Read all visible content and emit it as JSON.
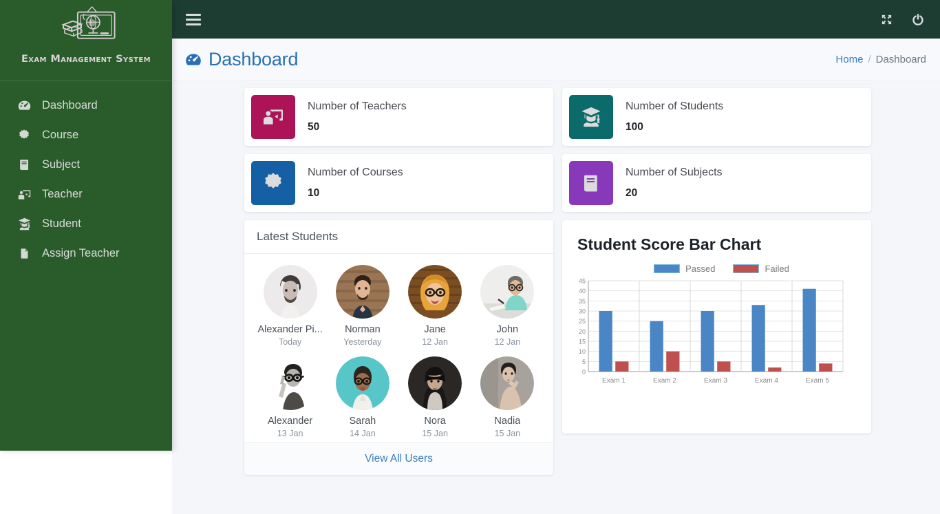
{
  "sidebar": {
    "brand_title": "Exam Management System",
    "logo_icon": "blackboard-globe-books-logo",
    "items": [
      {
        "label": "Dashboard",
        "icon": "tachometer-icon"
      },
      {
        "label": "Course",
        "icon": "certificate-icon"
      },
      {
        "label": "Subject",
        "icon": "book-icon"
      },
      {
        "label": "Teacher",
        "icon": "chalkboard-teacher-icon"
      },
      {
        "label": "Student",
        "icon": "user-graduate-icon"
      },
      {
        "label": "Assign Teacher",
        "icon": "file-icon"
      }
    ]
  },
  "topbar": {
    "menu_icon": "hamburger-icon",
    "fullscreen_icon": "expand-arrows-icon",
    "power_icon": "power-off-icon"
  },
  "page": {
    "title": "Dashboard",
    "title_icon": "tachometer-icon",
    "breadcrumb": {
      "home": "Home",
      "separator": "/",
      "current": "Dashboard"
    }
  },
  "stats": [
    {
      "label": "Number of Teachers",
      "value": "50",
      "icon": "chalkboard-teacher-icon",
      "color": "#ad1457"
    },
    {
      "label": "Number of Students",
      "value": "100",
      "icon": "user-graduate-icon",
      "color": "#0b6b6b"
    },
    {
      "label": "Number of Courses",
      "value": "10",
      "icon": "certificate-icon",
      "color": "#1560a4"
    },
    {
      "label": "Number of Subjects",
      "value": "20",
      "icon": "book-icon",
      "color": "#8739ba"
    }
  ],
  "students_panel": {
    "title": "Latest Students",
    "view_all_label": "View All Users",
    "students": [
      {
        "name": "Alexander Pi...",
        "date": "Today",
        "avatar": "man-beard-grayscale-avatar"
      },
      {
        "name": "Norman",
        "date": "Yesterday",
        "avatar": "man-wood-background-avatar"
      },
      {
        "name": "Jane",
        "date": "12 Jan",
        "avatar": "woman-glasses-orange-avatar"
      },
      {
        "name": "John",
        "date": "12 Jan",
        "avatar": "man-desk-writing-avatar"
      },
      {
        "name": "Alexander",
        "date": "13 Jan",
        "avatar": "man-glasses-pointing-avatar"
      },
      {
        "name": "Sarah",
        "date": "14 Jan",
        "avatar": "woman-glasses-teal-avatar"
      },
      {
        "name": "Nora",
        "date": "15 Jan",
        "avatar": "woman-dark-hair-avatar"
      },
      {
        "name": "Nadia",
        "date": "15 Jan",
        "avatar": "woman-hand-chin-avatar"
      }
    ]
  },
  "chart_data": {
    "type": "bar",
    "title": "Student Score Bar Chart",
    "categories": [
      "Exam 1",
      "Exam 2",
      "Exam 3",
      "Exam 4",
      "Exam 5"
    ],
    "series": [
      {
        "name": "Passed",
        "color": "#4a86c5",
        "values": [
          30,
          25,
          30,
          33,
          41
        ]
      },
      {
        "name": "Failed",
        "color": "#c0504d",
        "values": [
          5,
          10,
          5,
          2,
          4
        ]
      }
    ],
    "xlabel": "",
    "ylabel": "",
    "ylim": [
      0,
      45
    ],
    "yticks": [
      0,
      5,
      10,
      15,
      20,
      25,
      30,
      35,
      40,
      45
    ],
    "grid": true,
    "legend_position": "top"
  },
  "colors": {
    "sidebar_green": "#2a5c2b",
    "topbar_green": "#1d3d33",
    "accent_blue": "#2a6fb5",
    "content_bg": "#f4f6fa"
  }
}
